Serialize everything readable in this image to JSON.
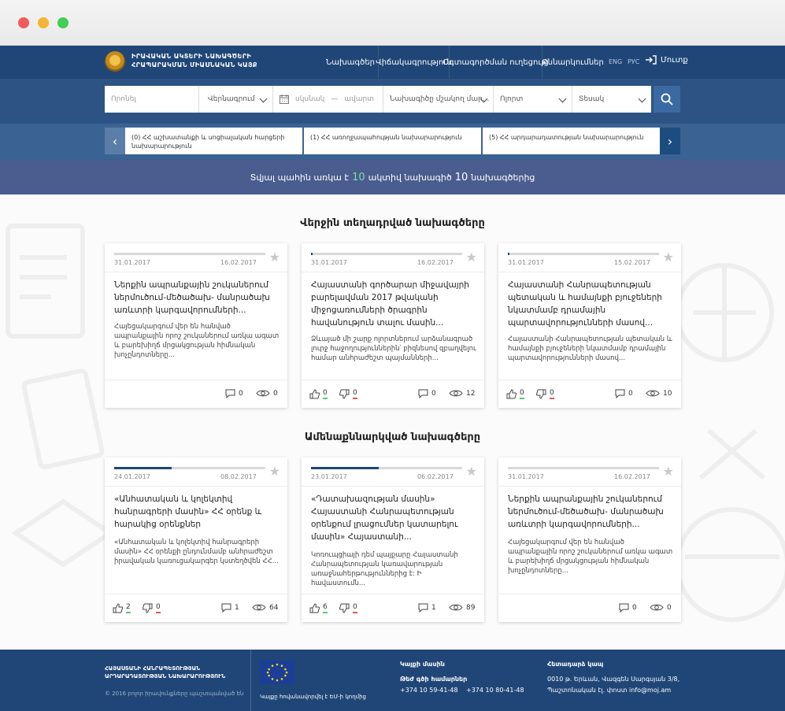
{
  "header": {
    "logo_line1": "ԻՐԱՎԱԿԱՆ ԱԿՏԵՐԻ ՆԱԽԱԳԾԵՐԻ",
    "logo_line2": "ՀՐԱՊԱՐԱԿՄԱՆ ՄԻԱՍՆԱԿԱՆ ԿԱՅՔ",
    "nav": [
      "Նախագծեր",
      "Վիճակագրություն",
      "Օգտագործման ուղեցույց",
      "Քննարկումներ"
    ],
    "lang_eng": "ENG",
    "lang_rus": "РУС",
    "login": "Մուտք"
  },
  "search": {
    "keyword_placeholder": "Որոնել",
    "type_select": "Վերնագրում",
    "date_from": "սկսնակ",
    "date_sep": "—",
    "date_to": "ավարտ",
    "author_select": "Նախագիծը մշակող մար...",
    "field_select": "Ոլորտ",
    "status_select": "Տեսակ"
  },
  "carousel": [
    {
      "count": "(0)",
      "name": "ՀՀ աշխատանքի և սոցիալական հարցերի նախարարություն"
    },
    {
      "count": "(1)",
      "name": "ՀՀ առողջապահության նախարարություն"
    },
    {
      "count": "(5)",
      "name": "ՀՀ արդարադատության նախարարություն"
    }
  ],
  "summary": {
    "prefix": "Տվյալ պահին առկա է",
    "active": "10",
    "middle": "ակտիվ նախագիծ",
    "total": "10",
    "suffix": "նախագծերից"
  },
  "sections": {
    "latest": "Վերջին տեղադրված նախագծերը",
    "discussed": "Ամենաքննարկված նախագծերը"
  },
  "cards_latest": [
    {
      "date_start": "31.01.2017",
      "date_end": "16.02.2017",
      "progress": 0,
      "title": "Ներքին ապրանքային շուկաներում ներմուծում-մեծածախ- մանրածախ առևտրի կարգավորումների...",
      "desc": "Հայեցակարգում վեր են հանված ապրանքային որոշ շուկաներում առկա ագատ և բարեխիղճ մրցակցության հիմնական խոչընդոտները...",
      "comments": "0",
      "views": "0"
    },
    {
      "date_start": "31.01.2017",
      "date_end": "16.02.2017",
      "progress": 0.01,
      "title": "Հայաստանի գործարար միջավայրի բարելավման 2017 թվականի միջոցառումների ծրագրին հավանություն տալու մասին...",
      "desc": "Ձևայած մի շարք ոլորտներում արձանագրած լուրջ հաջողություններին՝ բիզնեսով զբաղվելու համար անհրաժեշտ պայմանների...",
      "likes": "0",
      "dislikes": "0",
      "comments": "0",
      "views": "12"
    },
    {
      "date_start": "31.01.2017",
      "date_end": "15.02.2017",
      "progress": 0.01,
      "title": "Հայաստանի Հանրապետության պետական և համայնքի բյուջեների նկատմամբ դրամային պարտավորությունների մասով...",
      "desc": "Հայաստանի Հանրապետության պետական և համայնքի բյուջեների նկատմամբ դրամային պարտավորությունների մասով...",
      "likes": "0",
      "dislikes": "0",
      "comments": "0",
      "views": "10"
    }
  ],
  "cards_discussed": [
    {
      "date_start": "24.01.2017",
      "date_end": "08.02.2017",
      "progress": 0.38,
      "title": "«Անհատական և կոլեկտիվ հանրագրերի մասին» ՀՀ օրենք և հարակից օրենքներ",
      "desc": "«Անհատական և կոլեկտիվ հանրագրերի մասին» ՀՀ օրենքի ընդունմամբ անհրաժեշտ իրավական կառուցակարգեր կստեղծվեն ՀՀ...",
      "likes": "2",
      "dislikes": "0",
      "comments": "1",
      "views": "64"
    },
    {
      "date_start": "23.01.2017",
      "date_end": "06.02.2017",
      "progress": 0.45,
      "title": "«Դատախազության մասին» Հայաստանի Հանրապետության օրենքում լրացումներ կատարելու մասին» Հայաստանի...",
      "desc": "Կոռուպցիայի դեմ պայքարը Հայաստանի Հանրապետության կառավարության առաջնահերթություններից է: Ի հավաստումն...",
      "likes": "6",
      "dislikes": "0",
      "comments": "1",
      "views": "89"
    },
    {
      "date_start": "31.01.2017",
      "date_end": "16.02.2017",
      "progress": 0,
      "title": "Ներքին ապրանքային շուկաներում ներմուծում-մեծածախ- մանրածախ առևտրի կարգավորումների...",
      "desc": "Հայեցակարգում վեր են հանված ապրանքային որոշ շուկաներում առկա ագատ և բարեխիղճ մրցակցության հիմնական խոչընդոտները...",
      "comments": "0",
      "views": "0"
    }
  ],
  "footer": {
    "org_line1": "ՀԱՅԱՍՏԱՆԻ ՀԱՆՐԱՊԵՏՈՒԹՅԱՆ",
    "org_line2": "ԱՐԴԱՐԱԴԱՏՈՒԹՅԱՆ ՆԱԽԱՐԱՐՈՒԹՅՈՒՆ",
    "copyright": "© 2016 բոլոր իրավունքները պաշտպանված են",
    "eu_caption": "Կայքը հովանավորվել է ԵՄ-ի կողմից",
    "about": "Կայքի մասին",
    "hotline_label": "Թեժ գծի համարներ",
    "phone1": "+374 10 59-41-48",
    "phone2": "+374 10 80-41-48",
    "feedback_label": "Հետադարձ կապ",
    "address1": "0010 թ. Երևան, Վազգեն Սարգսյան 3/8,",
    "address2": "Պաշտոնական էլ. փոստ info@moj.am"
  }
}
